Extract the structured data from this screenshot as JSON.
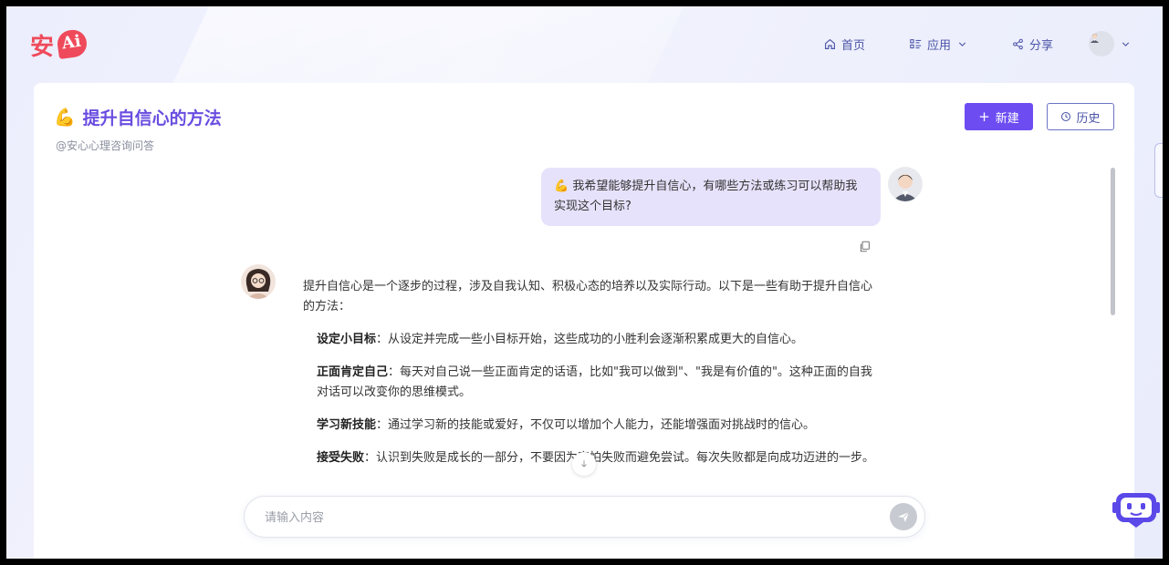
{
  "header": {
    "logo_text": "安AI",
    "nav": {
      "home": "首页",
      "apps": "应用",
      "share": "分享"
    }
  },
  "page": {
    "emoji": "💪",
    "title": "提升自信心的方法",
    "subtitle": "@安心心理咨询问答",
    "new_button": "新建",
    "history_button": "历史"
  },
  "chat": {
    "user_message": "💪 我希望能够提升自信心，有哪些方法或练习可以帮助我实现这个目标?",
    "answer_intro": "提升自信心是一个逐步的过程，涉及自我认知、积极心态的培养以及实际行动。以下是一些有助于提升自信心的方法：",
    "answer_items": [
      {
        "title": "设定小目标",
        "text": "：从设定并完成一些小目标开始，这些成功的小胜利会逐渐积累成更大的自信心。"
      },
      {
        "title": "正面肯定自己",
        "text": "：每天对自己说一些正面肯定的话语，比如\"我可以做到\"、\"我是有价值的\"。这种正面的自我对话可以改变你的思维模式。"
      },
      {
        "title": "学习新技能",
        "text": "：通过学习新的技能或爱好，不仅可以增加个人能力，还能增强面对挑战时的信心。"
      },
      {
        "title": "接受失败",
        "text": "：认识到失败是成长的一部分，不要因为害怕失败而避免尝试。每次失败都是向成功迈进的一步。"
      }
    ]
  },
  "input": {
    "placeholder": "请输入内容"
  },
  "colors": {
    "accent": "#6d4df2",
    "title": "#6a4de0",
    "user_bubble": "#e7e2fb",
    "logo": "#ef4a5b"
  }
}
